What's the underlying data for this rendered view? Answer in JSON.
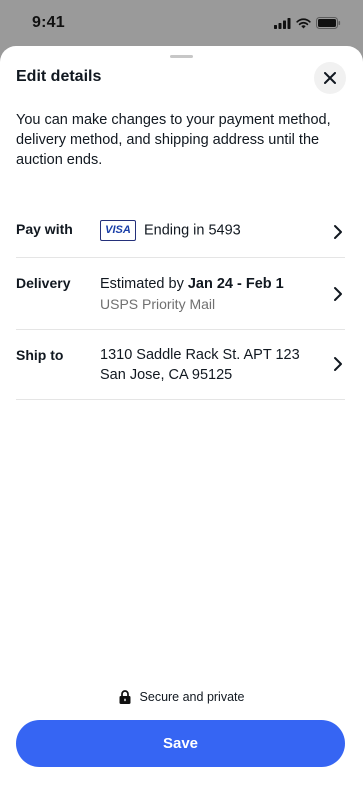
{
  "status_bar": {
    "time": "9:41"
  },
  "sheet": {
    "title": "Edit details",
    "intro": "You can make changes to your payment method, delivery method, and shipping address until the auction ends."
  },
  "pay_with": {
    "label": "Pay with",
    "card_brand": "VISA",
    "text": "Ending in 5493"
  },
  "delivery": {
    "label": "Delivery",
    "estimate_prefix": "Estimated by ",
    "estimate_dates": "Jan 24 - Feb 1",
    "service": "USPS Priority Mail"
  },
  "ship_to": {
    "label": "Ship to",
    "line1": "1310 Saddle Rack St. APT 123",
    "line2": "San Jose, CA 95125"
  },
  "footer": {
    "secure_text": "Secure and private",
    "save_label": "Save"
  },
  "colors": {
    "accent": "#3665f3",
    "backdrop": "#9a9a9a",
    "divider": "#e5e5e5"
  }
}
